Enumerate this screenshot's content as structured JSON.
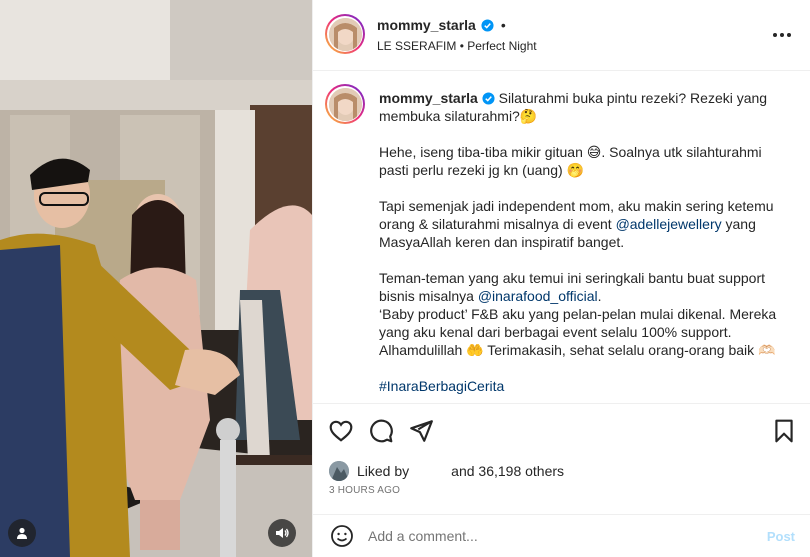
{
  "header": {
    "username": "mommy_starla",
    "separator": "•",
    "music": "LE SSERAFIM • Perfect Night"
  },
  "caption": {
    "username": "mommy_starla",
    "line1": "Silaturahmi buka pintu rezeki? Rezeki yang membuka silaturahmi?🤔",
    "para2": "Hehe, iseng tiba-tiba mikir gituan 😅. Soalnya utk silahturahmi pasti perlu rezeki jg kn (uang) 🤭",
    "para3_before": "Tapi semenjak jadi independent mom, aku makin sering ketemu orang & silaturahmi misalnya di event ",
    "para3_link": "@adellejewellery",
    "para3_after": " yang MasyaAllah keren dan inspiratif banget.",
    "para4_before": "Teman-teman yang aku temui ini seringkali bantu buat support bisnis misalnya ",
    "para4_link": "@inarafood_official",
    "para4_after": ".",
    "para4_line2": "‘Baby product’ F&B aku yang pelan-pelan mulai dikenal. Mereka yang aku kenal dari berbagai event selalu 100% support. Alhamdulillah 🤲 Terimakasih, sehat selalu orang-orang baik 🫶🏻",
    "hashtag": "#InaraBerbagiCerita"
  },
  "likes": {
    "liked_by": "Liked by",
    "and_others": "and 36,198 others"
  },
  "timestamp": "3 HOURS AGO",
  "comment": {
    "placeholder": "Add a comment...",
    "post_label": "Post"
  },
  "colors": {
    "link": "#00376b",
    "verified": "#0095f6",
    "post_disabled": "#b2dffc"
  },
  "icons": [
    "heart-icon",
    "comment-icon",
    "share-icon",
    "bookmark-icon",
    "emoji-icon",
    "more-icon",
    "user-tag-icon",
    "audio-icon",
    "verified-icon"
  ]
}
